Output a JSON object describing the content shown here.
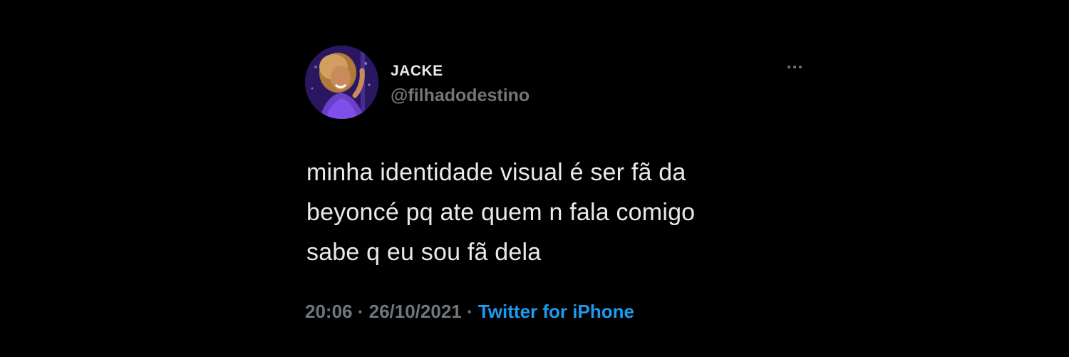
{
  "tweet": {
    "display_name": "JACKE",
    "handle": "@filhadodestino",
    "more_icon": "more-dots-icon",
    "text_lines": [
      "minha identidade visual é ser fã da",
      "beyoncé pq ate quem n fala comigo",
      "sabe q eu sou fã dela"
    ],
    "time": "20:06",
    "separator": " · ",
    "date": "26/10/2021",
    "source": "Twitter for iPhone"
  },
  "colors": {
    "background": "#000000",
    "primary_text": "#e7e9ea",
    "secondary_text": "#71767b",
    "link": "#1d9bf0"
  }
}
